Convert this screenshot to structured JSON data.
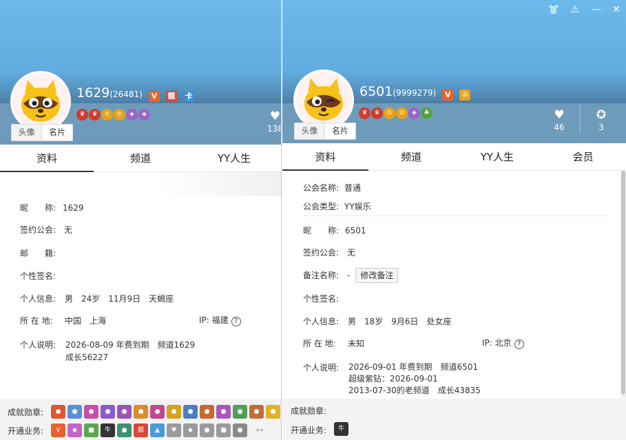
{
  "left": {
    "avatar_tabs": [
      "头像",
      "名片"
    ],
    "name": "1629",
    "uid": "(26481)",
    "stat_likes": "138",
    "tabs": [
      "资料",
      "频道",
      "YY人生"
    ],
    "fields": {
      "nickname_label": "昵　　称:",
      "nickname": "1629",
      "guild_label": "签约公会:",
      "guild": "无",
      "mail_label": "邮　　籍:",
      "signature_label": "个性签名:",
      "info_label": "个人信息:",
      "info": "男　24岁　11月9日　天蝎座",
      "location_label": "所 在 地:",
      "location": "中国　上海",
      "ip_label": "IP:",
      "ip": "福建",
      "desc_label": "个人说明:",
      "desc_line1": "2026-08-09 年费到期　频道1629",
      "desc_line2": "成长56227"
    },
    "achievements_label": "成就勋章:",
    "services_label": "开通业务:"
  },
  "right": {
    "avatar_tabs": [
      "头像",
      "名片"
    ],
    "name": "6501",
    "uid": "(9999279)",
    "stat_likes": "46",
    "stat_medals": "3",
    "tabs": [
      "资料",
      "频道",
      "YY人生",
      "会员"
    ],
    "fields": {
      "guild_name_label": "公会名称:",
      "guild_name": "普通",
      "guild_type_label": "公会类型:",
      "guild_type": "YY娱乐",
      "nickname_label": "昵　　称:",
      "nickname": "6501",
      "guild_label": "签约公会:",
      "guild": "无",
      "remark_label": "备注名称:",
      "remark": "-",
      "remark_button": "修改备注",
      "signature_label": "个性签名:",
      "info_label": "个人信息:",
      "info": "男　18岁　9月6日　处女座",
      "location_label": "所 在 地:",
      "location": "未知",
      "ip_label": "IP:",
      "ip": "北京",
      "desc_label": "个人说明:",
      "desc_line1": "2026-09-01 年费到期　频道6501",
      "desc_line2": "超级紫钻：2026-09-01",
      "desc_line3": "2013-07-30的老频道　成长43835"
    },
    "achievements_label": "成就勋章:",
    "services_label": "开通业务:"
  },
  "badges": {
    "v": "V",
    "liang": "靓",
    "card": "卡",
    "niu": "牛",
    "help": "?"
  },
  "icons": {
    "heart": "heart-icon",
    "medal": "medal-icon",
    "skin": "shirt-icon",
    "warn": "warning-icon",
    "min": "minimize-icon",
    "close": "close-icon"
  },
  "colors": {
    "banner": "#62acdf",
    "v_badge": "#e8622c",
    "liang_badge": "#d9453b",
    "card_badge": "#3d8fd6",
    "crown": "#d23a2a",
    "gold": "#e6a317",
    "purple": "#9a63c9"
  }
}
